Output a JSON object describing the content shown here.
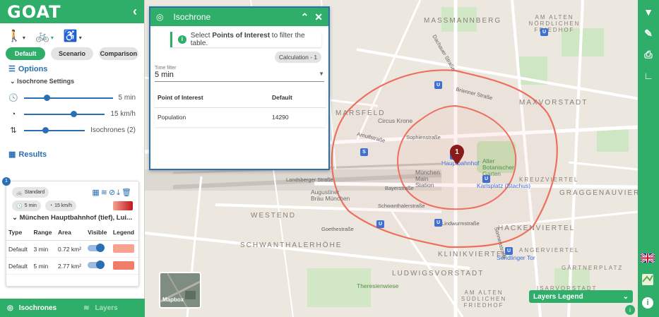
{
  "app": {
    "logo": "GOAT",
    "collapse": "‹"
  },
  "modes": [
    {
      "name": "walk",
      "glyph": "🚶"
    },
    {
      "name": "bike",
      "glyph": "🚲"
    },
    {
      "name": "wheelchair",
      "glyph": "♿"
    }
  ],
  "tabs": [
    "Default",
    "Scenario",
    "Comparison"
  ],
  "options": {
    "title": "Options",
    "settings_title": "Isochrone Settings",
    "time_value": "5 min",
    "speed_value": "15 km/h",
    "isochrones_value": "Isochrones (2)"
  },
  "results": {
    "title": "Results",
    "card_badge": "1",
    "mode_chip": "Standard",
    "time_chip": "5 min",
    "speed_chip": "15 km/h",
    "start_title": "München Hauptbahnhof (tief), Lui...",
    "columns": [
      "Type",
      "Range",
      "Area",
      "Visible",
      "Legend"
    ],
    "rows": [
      {
        "type": "Default",
        "range": "3 min",
        "area": "0.72 km²",
        "legend_color": "#f6a28f"
      },
      {
        "type": "Default",
        "range": "5 min",
        "area": "2.77 km²",
        "legend_color": "#f07d6a"
      }
    ]
  },
  "bottom_nav": {
    "isochrones": "Isochrones",
    "layers": "Layers"
  },
  "popup": {
    "title": "Isochrone",
    "info_prefix": "Select ",
    "info_bold": "Points of Interest",
    "info_suffix": " to filter the table.",
    "calc_chip": "Calculation - 1",
    "time_filter_label": "Time filter",
    "time_filter_value": "5 min",
    "columns": [
      "Point of Interest",
      "Default"
    ],
    "rows": [
      {
        "poi": "Population",
        "value": "14290"
      }
    ]
  },
  "map": {
    "mapbox_label": "Mapbox",
    "layers_legend": "Layers Legend",
    "marker_number": "1",
    "districts": [
      "MASSMANNBERG",
      "AM ALTEN NÖRDLICHEN FRIEDHOF",
      "MAXVORSTADT",
      "MARSFELD",
      "WESTEND",
      "SCHWANTHALERHÖHE",
      "KLINIKVIERTEL",
      "LUDWIGSVORSTADT",
      "HACKENVIERTEL",
      "ANGERVIERTEL",
      "GRAGGENAUVIERTEL",
      "KREUZVIERTEL",
      "AM ALTEN SÜDLICHEN FRIEDHOF",
      "ISARVORSTADT",
      "GÄRTNERPLATZ"
    ],
    "streets": [
      "Arnulfstraße",
      "Bayerstraße",
      "Landsberger Straße",
      "Schwanthalerstraße",
      "Goethestraße",
      "Lindwurmstraße",
      "Sonnenstraße",
      "Brienner Straße",
      "Sophienstraße",
      "Dachauer Straße"
    ],
    "places": [
      "Hauptbahnhof",
      "München Main Station",
      "Alter Botanischer Garten",
      "Augustiner Bräu München",
      "Theresienwiese",
      "Circus Krone",
      "Karlsplatz (Stachus)",
      "Sendlinger Tor"
    ]
  },
  "colors": {
    "accent": "#2fae6a",
    "blue": "#2b6fb3",
    "isoline": "#ee6f5d"
  },
  "toolbar_icons": [
    "filter-icon",
    "edit-icon",
    "print-icon",
    "ruler-icon"
  ]
}
